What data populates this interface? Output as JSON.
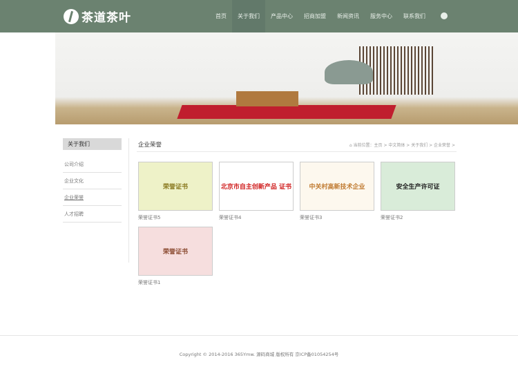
{
  "header": {
    "logo": "茶道茶叶",
    "nav": [
      "首页",
      "关于我们",
      "产品中心",
      "招商加盟",
      "新闻资讯",
      "服务中心",
      "联系我们"
    ],
    "active": 1
  },
  "sidebar": {
    "title": "关于我们",
    "items": [
      "公司介绍",
      "企业文化",
      "企业荣誉",
      "人才招聘"
    ]
  },
  "main": {
    "title": "企业荣誉",
    "breadcrumb": "当前位置：主页 > 中文简体 > 关于我们 > 企业荣誉 >",
    "items": [
      {
        "caption": "荣誉证书5",
        "thumb_text": "荣誉证书",
        "bg": "#eef2c8",
        "color": "#8a7a20"
      },
      {
        "caption": "荣誉证书4",
        "thumb_text": "北京市自主创新产品 证书",
        "bg": "#ffffff",
        "color": "#d02020"
      },
      {
        "caption": "荣誉证书3",
        "thumb_text": "中关村高新技术企业",
        "bg": "#fdf8ee",
        "color": "#c07a30"
      },
      {
        "caption": "荣誉证书2",
        "thumb_text": "安全生产许可证",
        "bg": "#d9ecd9",
        "color": "#222"
      },
      {
        "caption": "荣誉证书1",
        "thumb_text": "荣誉证书",
        "bg": "#f6dede",
        "color": "#8a4a30"
      }
    ]
  },
  "footer": {
    "text": "Copyright © 2014-2016 365Ymw. 源码商城 版权所有    京ICP备01054254号"
  }
}
